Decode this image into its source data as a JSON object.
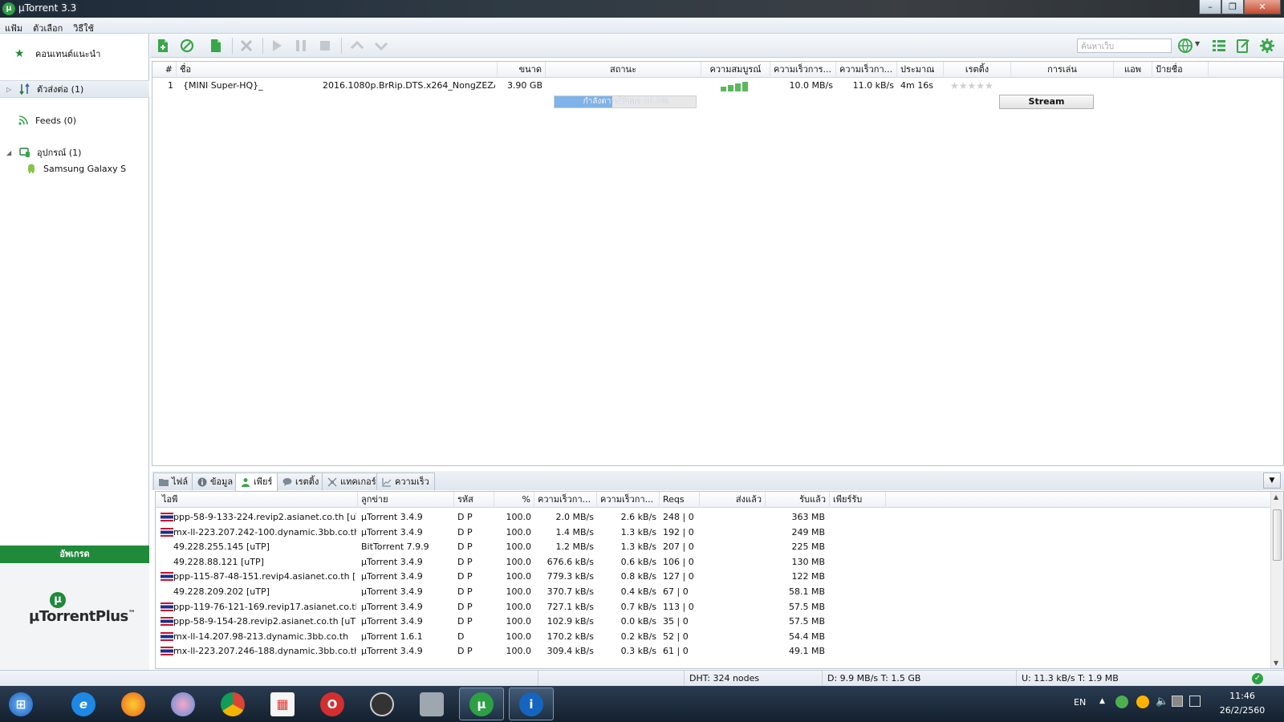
{
  "window": {
    "title": "µTorrent 3.3",
    "minimize": "–",
    "restore": "❐",
    "close": "✕"
  },
  "menu": {
    "items": [
      "แฟ้ม",
      "ตัวเลือก",
      "วิธีใช้"
    ]
  },
  "sidebar": {
    "featured": "คอนเทนต์แนะนำ",
    "torrents": "ตัวส่งต่อ (1)",
    "feeds": "Feeds (0)",
    "devices": "อุปกรณ์ (1)",
    "device_item": "Samsung Galaxy S",
    "upgrade": "อัพเกรด",
    "plus_logo": "µTorrentPlus",
    "plus_tm": "™"
  },
  "search": {
    "placeholder": "ค้นหาเว็บ"
  },
  "torrent_columns": [
    "#",
    "ชื่อ",
    "ขนาด",
    "สถานะ",
    "ความสมบูรณ์",
    "ความเร็วการ...",
    "ความเร็วกา...",
    "ประมาณ",
    "เรตติ้ง",
    "การเล่น",
    "แอพ",
    "ป้ายชื่อ"
  ],
  "torrent": {
    "num": "1",
    "name_a": "{MINI Super-HQ}_",
    "name_b": "2016.1080p.BrRip.DTS.x264_NongZEZA...",
    "size": "3.90 GB",
    "status": "กำลังดาวน์โหลด 40.3%",
    "progress": 40.3,
    "down": "10.0 MB/s",
    "up": "11.0 kB/s",
    "eta": "4m 16s",
    "rating_stars": 5,
    "play": "Stream"
  },
  "tabs": [
    "ไฟล์",
    "ข้อมูล",
    "เพียร์",
    "เรตติ้ง",
    "แทคเกอร์",
    "ความเร็ว"
  ],
  "peer_columns": [
    "ไอพี",
    "ลูกข่าย",
    "รหัส",
    "%",
    "ความเร็วกา...",
    "ความเร็วกา...",
    "Reqs",
    "ส่งแล้ว",
    "รับแล้ว",
    "เพียร์รับ"
  ],
  "peers": [
    {
      "ip": "ppp-58-9-133-224.revip2.asianet.co.th [uTP]",
      "client": "µTorrent 3.4.9",
      "flags": "D P",
      "pct": "100.0",
      "down": "2.0 MB/s",
      "up": "2.6 kB/s",
      "reqs": "248 | 0",
      "uploaded": "",
      "downloaded": "363 MB",
      "flag": true
    },
    {
      "ip": "mx-ll-223.207.242-100.dynamic.3bb.co.th ...",
      "client": "µTorrent 3.4.9",
      "flags": "D P",
      "pct": "100.0",
      "down": "1.4 MB/s",
      "up": "1.3 kB/s",
      "reqs": "192 | 0",
      "uploaded": "",
      "downloaded": "249 MB",
      "flag": true
    },
    {
      "ip": "49.228.255.145 [uTP]",
      "client": "BitTorrent 7.9.9",
      "flags": "D P",
      "pct": "100.0",
      "down": "1.2 MB/s",
      "up": "1.3 kB/s",
      "reqs": "207 | 0",
      "uploaded": "",
      "downloaded": "225 MB",
      "flag": false
    },
    {
      "ip": "49.228.88.121 [uTP]",
      "client": "µTorrent 3.4.9",
      "flags": "D P",
      "pct": "100.0",
      "down": "676.6 kB/s",
      "up": "0.6 kB/s",
      "reqs": "106 | 0",
      "uploaded": "",
      "downloaded": "130 MB",
      "flag": false
    },
    {
      "ip": "ppp-115-87-48-151.revip4.asianet.co.th [u...",
      "client": "µTorrent 3.4.9",
      "flags": "D P",
      "pct": "100.0",
      "down": "779.3 kB/s",
      "up": "0.8 kB/s",
      "reqs": "127 | 0",
      "uploaded": "",
      "downloaded": "122 MB",
      "flag": true
    },
    {
      "ip": "49.228.209.202 [uTP]",
      "client": "µTorrent 3.4.9",
      "flags": "D P",
      "pct": "100.0",
      "down": "370.7 kB/s",
      "up": "0.4 kB/s",
      "reqs": "67 | 0",
      "uploaded": "",
      "downloaded": "58.1 MB",
      "flag": false
    },
    {
      "ip": "ppp-119-76-121-169.revip17.asianet.co.th ...",
      "client": "µTorrent 3.4.9",
      "flags": "D P",
      "pct": "100.0",
      "down": "727.1 kB/s",
      "up": "0.7 kB/s",
      "reqs": "113 | 0",
      "uploaded": "",
      "downloaded": "57.5 MB",
      "flag": true
    },
    {
      "ip": "ppp-58-9-154-28.revip2.asianet.co.th [uTP]",
      "client": "µTorrent 3.4.9",
      "flags": "D P",
      "pct": "100.0",
      "down": "102.9 kB/s",
      "up": "0.0 kB/s",
      "reqs": "35 | 0",
      "uploaded": "",
      "downloaded": "57.5 MB",
      "flag": true
    },
    {
      "ip": "mx-ll-14.207.98-213.dynamic.3bb.co.th",
      "client": "µTorrent 1.6.1",
      "flags": "D",
      "pct": "100.0",
      "down": "170.2 kB/s",
      "up": "0.2 kB/s",
      "reqs": "52 | 0",
      "uploaded": "",
      "downloaded": "54.4 MB",
      "flag": true
    },
    {
      "ip": "mx-ll-223.207.246-188.dynamic.3bb.co.th ...",
      "client": "µTorrent 3.4.9",
      "flags": "D P",
      "pct": "100.0",
      "down": "309.4 kB/s",
      "up": "0.3 kB/s",
      "reqs": "61 | 0",
      "uploaded": "",
      "downloaded": "49.1 MB",
      "flag": true
    }
  ],
  "status": {
    "dht": "DHT: 324 nodes",
    "download": "D: 9.9 MB/s T: 1.5 GB",
    "upload": "U: 11.3 kB/s T: 1.9 MB"
  },
  "taskbar": {
    "lang": "EN",
    "time": "11:46",
    "date": "26/2/2560"
  },
  "colors": {
    "accent_green": "#1f8a3a",
    "progress_blue": "#7fb3ea"
  }
}
